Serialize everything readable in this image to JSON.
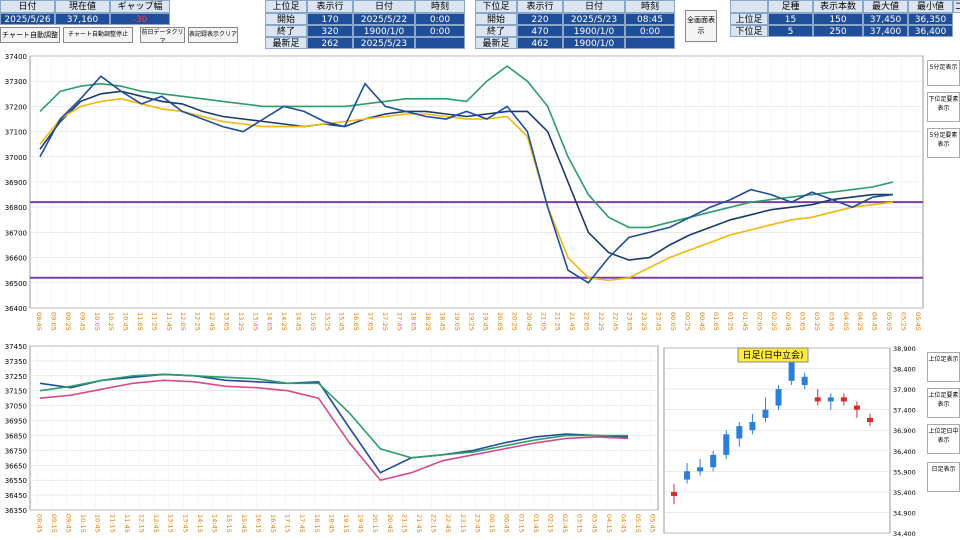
{
  "top_left": {
    "headers": [
      "日付",
      "現在値",
      "ギャップ幅"
    ],
    "values": [
      "2025/5/26",
      "37,160",
      "-30"
    ]
  },
  "buttons": {
    "chart_auto_adjust": "チャート自動調整",
    "chart_auto_adjust_stop": "チャート自動調整停止",
    "prev_day_clear": "前日データクリア",
    "chart_record_clear": "表記録表示クリア"
  },
  "table_a": {
    "headers": [
      "上位足",
      "表示行",
      "日付",
      "時刻"
    ],
    "rows": [
      [
        "開始",
        "170",
        "2025/5/22",
        "0:00"
      ],
      [
        "終了",
        "320",
        "1900/1/0",
        "0:00"
      ],
      [
        "最新足",
        "262",
        "2025/5/23",
        ""
      ]
    ]
  },
  "table_b": {
    "headers": [
      "下位足",
      "表示行",
      "日付",
      "時刻"
    ],
    "rows": [
      [
        "開始",
        "220",
        "2025/5/23",
        "08:45"
      ],
      [
        "終了",
        "470",
        "1900/1/0",
        "0:00"
      ],
      [
        "最新足",
        "462",
        "1900/1/0",
        ""
      ]
    ]
  },
  "full_view_button": "全画面表示",
  "table_c": {
    "headers": [
      "",
      "足種",
      "表示本数",
      "最大値",
      "最小値",
      "コ"
    ],
    "rows": [
      [
        "上位足",
        "15",
        "150",
        "37,450",
        "36,350"
      ],
      [
        "下位足",
        "5",
        "250",
        "37,400",
        "36,400"
      ]
    ]
  },
  "side_buttons": {
    "five_min": "5分足表示",
    "lower_elements": "下位足要素表示",
    "five_min_ichimoku": "5分足要素表示",
    "upper_show": "上位足表示",
    "upper_elements": "上位足要素表示",
    "upper_daily": "上位足日中表示",
    "daily": "日足表示"
  },
  "chart1": {
    "type": "line",
    "y_ticks": [
      "37400",
      "37300",
      "37200",
      "37100",
      "37000",
      "36900",
      "36800",
      "36700",
      "36600",
      "36500",
      "36400"
    ],
    "x_ticks": [
      "08:45",
      "09:05",
      "09:25",
      "09:45",
      "10:05",
      "10:25",
      "10:45",
      "11:05",
      "11:25",
      "11:45",
      "12:05",
      "12:25",
      "12:45",
      "13:05",
      "13:25",
      "13:45",
      "14:05",
      "14:25",
      "14:45",
      "15:05",
      "15:25",
      "15:45",
      "16:05",
      "17:05",
      "17:25",
      "17:45",
      "18:05",
      "18:25",
      "18:45",
      "19:05",
      "19:25",
      "19:45",
      "20:05",
      "20:25",
      "20:45",
      "21:05",
      "21:25",
      "21:45",
      "22:05",
      "22:25",
      "22:45",
      "23:05",
      "23:25",
      "23:45",
      "00:05",
      "00:25",
      "00:45",
      "01:05",
      "01:25",
      "01:45",
      "02:05",
      "02:25",
      "02:45",
      "03:05",
      "03:25",
      "03:45",
      "04:05",
      "04:25",
      "04:45",
      "05:05",
      "05:25",
      "05:45"
    ],
    "ylim": [
      36400,
      37400
    ],
    "series": [
      {
        "color": "#1a3a6b",
        "values": [
          37030,
          37140,
          37220,
          37250,
          37260,
          37240,
          37220,
          37210,
          37180,
          37160,
          37150,
          37140,
          37130,
          37120,
          37130,
          37120,
          37150,
          37170,
          37180,
          37180,
          37170,
          37160,
          37170,
          37180,
          37180,
          37100,
          36900,
          36700,
          36620,
          36590,
          36600,
          36650,
          36690,
          36720,
          36750,
          36770,
          36790,
          36800,
          36810,
          36830,
          36840,
          36850,
          36850
        ]
      },
      {
        "color": "#f2b70f",
        "values": [
          37050,
          37150,
          37200,
          37220,
          37230,
          37210,
          37190,
          37180,
          37160,
          37140,
          37130,
          37120,
          37120,
          37120,
          37130,
          37140,
          37150,
          37160,
          37170,
          37170,
          37160,
          37150,
          37150,
          37160,
          37080,
          36800,
          36600,
          36520,
          36510,
          36520,
          36560,
          36600,
          36630,
          36660,
          36690,
          36710,
          36730,
          36750,
          36760,
          36780,
          36800,
          36810,
          36820
        ]
      },
      {
        "color": "#2e9b6b",
        "values": [
          37180,
          37260,
          37280,
          37290,
          37280,
          37260,
          37250,
          37240,
          37230,
          37220,
          37210,
          37200,
          37200,
          37200,
          37200,
          37200,
          37210,
          37220,
          37230,
          37230,
          37230,
          37220,
          37300,
          37360,
          37300,
          37200,
          37000,
          36850,
          36760,
          36720,
          36720,
          36740,
          36760,
          36780,
          36800,
          36820,
          36830,
          36840,
          36850,
          36860,
          36870,
          36880,
          36900
        ]
      },
      {
        "color": "#1f4e9a",
        "values": [
          37000,
          37150,
          37230,
          37320,
          37260,
          37210,
          37240,
          37180,
          37150,
          37120,
          37100,
          37150,
          37200,
          37180,
          37140,
          37120,
          37290,
          37200,
          37180,
          37160,
          37150,
          37180,
          37150,
          37200,
          37100,
          36800,
          36550,
          36500,
          36600,
          36680,
          36700,
          36720,
          36760,
          36800,
          36830,
          36870,
          36850,
          36820,
          36860,
          36830,
          36800,
          36840,
          36850
        ]
      }
    ],
    "hlines": [
      {
        "value": 36820,
        "color": "#7b3fa0"
      },
      {
        "value": 36520,
        "color": "#7b3fa0"
      }
    ]
  },
  "chart2": {
    "type": "line",
    "y_ticks": [
      "37450",
      "37350",
      "37250",
      "37150",
      "37050",
      "36950",
      "36850",
      "36750",
      "36650",
      "36550",
      "36450",
      "36350"
    ],
    "x_ticks": [
      "08:45",
      "09:15",
      "09:45",
      "10:15",
      "10:45",
      "11:15",
      "11:45",
      "12:15",
      "12:45",
      "13:15",
      "13:45",
      "14:15",
      "14:45",
      "15:15",
      "15:45",
      "16:15",
      "16:45",
      "17:15",
      "17:45",
      "18:15",
      "18:45",
      "19:15",
      "19:45",
      "20:15",
      "20:45",
      "21:15",
      "21:45",
      "22:15",
      "22:45",
      "23:15",
      "23:45",
      "00:15",
      "00:45",
      "01:15",
      "01:45",
      "02:15",
      "02:45",
      "03:15",
      "03:45",
      "04:15",
      "04:45",
      "05:15",
      "05:45"
    ],
    "ylim": [
      36350,
      37450
    ],
    "series": [
      {
        "color": "#1f4e9a",
        "values": [
          37200,
          37170,
          37220,
          37240,
          37260,
          37250,
          37220,
          37210,
          37200,
          37210,
          36900,
          36600,
          36700,
          36720,
          36750,
          36800,
          36840,
          36860,
          36850,
          36840
        ]
      },
      {
        "color": "#2e9b6b",
        "values": [
          37150,
          37180,
          37220,
          37250,
          37260,
          37250,
          37240,
          37230,
          37200,
          37200,
          37000,
          36760,
          36700,
          36720,
          36740,
          36780,
          36820,
          36850,
          36850,
          36850
        ]
      },
      {
        "color": "#d64a8c",
        "values": [
          37100,
          37120,
          37160,
          37200,
          37220,
          37210,
          37180,
          37170,
          37150,
          37100,
          36800,
          36550,
          36600,
          36680,
          36720,
          36760,
          36800,
          36830,
          36840,
          36830
        ]
      }
    ]
  },
  "chart3": {
    "title": "日足(日中立会)",
    "y_ticks": [
      "38,900",
      "38,400",
      "37,900",
      "37,400",
      "36,900",
      "36,400",
      "35,900",
      "35,400",
      "34,900",
      "34,400"
    ],
    "ylim": [
      34400,
      38900
    ],
    "candles": [
      {
        "o": 35400,
        "c": 35300,
        "h": 35600,
        "l": 35100
      },
      {
        "o": 35700,
        "c": 35900,
        "h": 36100,
        "l": 35600
      },
      {
        "o": 35900,
        "c": 36000,
        "h": 36200,
        "l": 35800
      },
      {
        "o": 36000,
        "c": 36300,
        "h": 36400,
        "l": 35900
      },
      {
        "o": 36300,
        "c": 36800,
        "h": 36900,
        "l": 36200
      },
      {
        "o": 36700,
        "c": 37000,
        "h": 37100,
        "l": 36500
      },
      {
        "o": 36900,
        "c": 37100,
        "h": 37300,
        "l": 36800
      },
      {
        "o": 37200,
        "c": 37400,
        "h": 37700,
        "l": 37100
      },
      {
        "o": 37500,
        "c": 37900,
        "h": 38000,
        "l": 37400
      },
      {
        "o": 38100,
        "c": 38600,
        "h": 38700,
        "l": 38000
      },
      {
        "o": 38000,
        "c": 38200,
        "h": 38300,
        "l": 37900
      },
      {
        "o": 37700,
        "c": 37600,
        "h": 37900,
        "l": 37500
      },
      {
        "o": 37600,
        "c": 37700,
        "h": 37800,
        "l": 37400
      },
      {
        "o": 37700,
        "c": 37600,
        "h": 37800,
        "l": 37500
      },
      {
        "o": 37500,
        "c": 37400,
        "h": 37600,
        "l": 37200
      },
      {
        "o": 37200,
        "c": 37100,
        "h": 37300,
        "l": 37000
      }
    ]
  }
}
